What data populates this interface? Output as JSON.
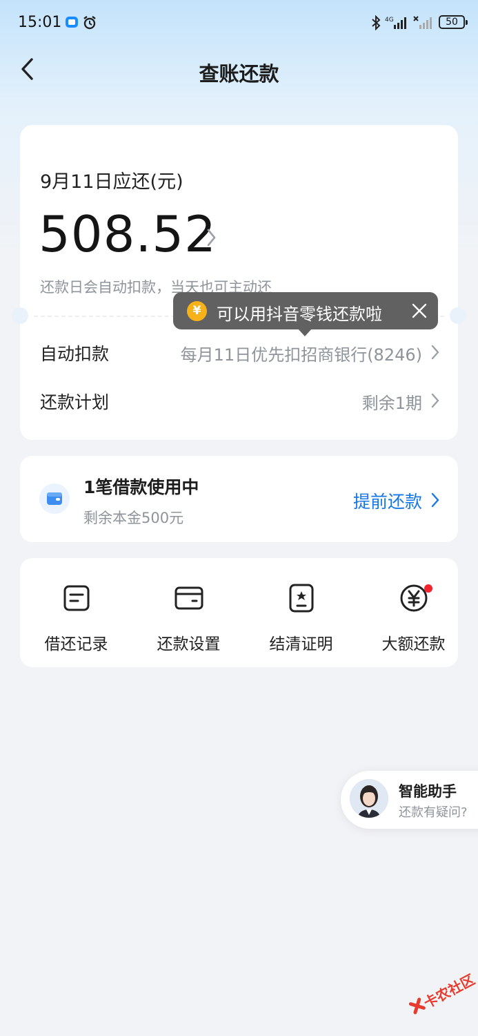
{
  "status_bar": {
    "time": "15:01",
    "network": "4G",
    "battery": "50"
  },
  "header": {
    "title": "查账还款"
  },
  "bill": {
    "due_label": "9月11日应还(元)",
    "amount": "508.52",
    "auto_note": "还款日会自动扣款，当天也可主动还",
    "auto_deduct_label": "自动扣款",
    "auto_deduct_value": "每月11日优先扣招商银行(8246)",
    "plan_label": "还款计划",
    "plan_value": "剩余1期"
  },
  "tooltip": {
    "coin_symbol": "¥",
    "text": "可以用抖音零钱还款啦"
  },
  "loan": {
    "title": "1笔借款使用中",
    "subtitle": "剩余本金500元",
    "prepay_label": "提前还款"
  },
  "actions": [
    {
      "label": "借还记录",
      "icon": "record-icon"
    },
    {
      "label": "还款设置",
      "icon": "card-settings-icon"
    },
    {
      "label": "结清证明",
      "icon": "certificate-icon"
    },
    {
      "label": "大额还款",
      "icon": "yuan-coin-icon"
    }
  ],
  "assistant": {
    "title": "智能助手",
    "subtitle": "还款有疑问?"
  },
  "watermark": {
    "text": "卡农社区"
  },
  "colors": {
    "accent": "#1677e5",
    "tooltip_bg": "#616161",
    "coin": "#f7b21a",
    "badge": "#f1232f"
  }
}
